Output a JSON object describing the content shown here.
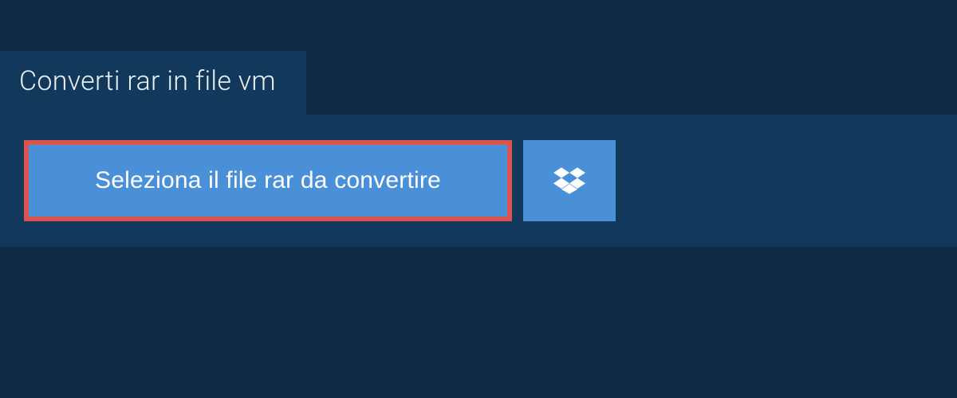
{
  "tab": {
    "label": "Converti rar in file vm"
  },
  "actions": {
    "select_file_label": "Seleziona il file rar da convertire"
  },
  "colors": {
    "background": "#0e2a47",
    "panel": "#12395c",
    "button": "#4a90d9",
    "highlight_border": "#d9544f"
  }
}
